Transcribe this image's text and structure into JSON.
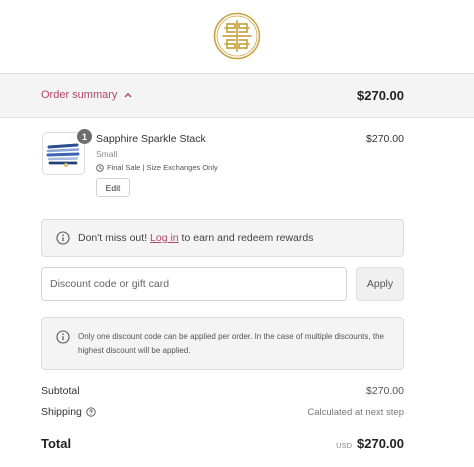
{
  "header": {
    "logo_icon": "gold-interlocking-monogram-logo"
  },
  "summary_bar": {
    "toggle_label": "Order summary",
    "toggle_icon": "chevron-up-icon",
    "total": "$270.00",
    "accent_color": "#b0466a"
  },
  "product": {
    "name": "Sapphire Sparkle Stack",
    "variant": "Small",
    "note": "Final Sale | Size Exchanges Only",
    "note_icon": "clock-icon",
    "quantity": "1",
    "edit_label": "Edit",
    "price": "$270.00",
    "thumbnail_icon": "bracelet-stack-image"
  },
  "rewards": {
    "icon": "info-icon",
    "text_before": "Don't miss out! ",
    "link_label": "Log in",
    "text_after": " to earn and redeem rewards"
  },
  "discount": {
    "placeholder": "Discount code or gift card",
    "value": "",
    "apply_label": "Apply",
    "note_icon": "info-icon",
    "note": "Only one discount code can be applied per order. In the case of multiple discounts, the highest discount will be applied."
  },
  "totals": {
    "subtotal_label": "Subtotal",
    "subtotal_value": "$270.00",
    "shipping_label": "Shipping",
    "shipping_icon": "question-circle-icon",
    "shipping_value": "Calculated at next step",
    "total_label": "Total",
    "currency": "USD",
    "total_value": "$270.00"
  }
}
